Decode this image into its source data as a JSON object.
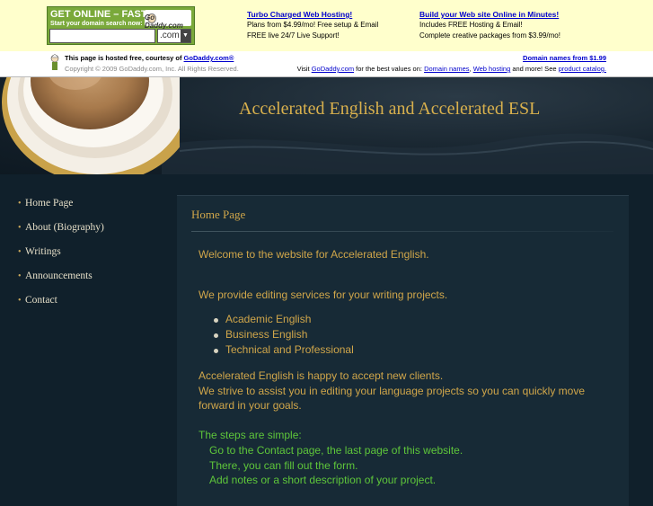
{
  "ad_banner": {
    "box_title": "GET ONLINE – FAST!",
    "box_subtitle": "Start your domain search now:",
    "logo_text": "Go Daddy.com",
    "search_value": "",
    "tld_value": ".com",
    "promo1": {
      "title": "Turbo Charged Web Hosting!",
      "line1": "Plans from $4.99/mo! Free setup & Email",
      "line2": "FREE live 24/7 Live Support!"
    },
    "promo2": {
      "title": "Build your Web site Online in Minutes!",
      "line1": "Includes FREE Hosting & Email!",
      "line2": "Complete creative packages from $3.99/mo!"
    }
  },
  "hosted_bar": {
    "hosted_prefix": "This page is hosted free, courtesy of ",
    "hosted_link": "GoDaddy.com®",
    "copyright": "Copyright © 2009 GoDaddy.com, Inc. All Rights Reserved.",
    "domain_link": "Domain names from $1.99",
    "visit_prefix": "Visit ",
    "visit_link": "GoDaddy.com",
    "visit_mid": " for the best values on: ",
    "link_domain_names": "Domain names",
    "comma": ", ",
    "link_web_hosting": "Web hosting",
    "visit_suffix": " and more! See ",
    "link_catalog": "product catalog."
  },
  "site": {
    "title": "Accelerated English and Accelerated ESL"
  },
  "nav": {
    "bullet": "•",
    "items": [
      {
        "label": "Home Page"
      },
      {
        "label": "About (Biography)"
      },
      {
        "label": "Writings"
      },
      {
        "label": "Announcements"
      },
      {
        "label": "Contact"
      }
    ]
  },
  "content": {
    "heading": "Home Page",
    "welcome": "Welcome to the website for Accelerated English.",
    "services_intro": "We provide editing services for your writing projects.",
    "services": [
      "Academic English",
      "Business English",
      "Technical and Professional"
    ],
    "happy": "Accelerated English is happy to accept new clients.",
    "strive_1": "We strive to assist you in editing your language projects so you can quickly move",
    "strive_2": "forward in your goals.",
    "steps_intro": "The steps are simple:",
    "steps": [
      "Go to the Contact page, the last page of this website.",
      "There, you can fill out the form.",
      "Add notes or a short description of your project."
    ]
  },
  "colors": {
    "banner_bg": "#ffffcc",
    "gold_text": "#d0a64a",
    "green_text": "#5ec63a",
    "page_bg": "#10202b",
    "link_blue": "#0000cc"
  }
}
